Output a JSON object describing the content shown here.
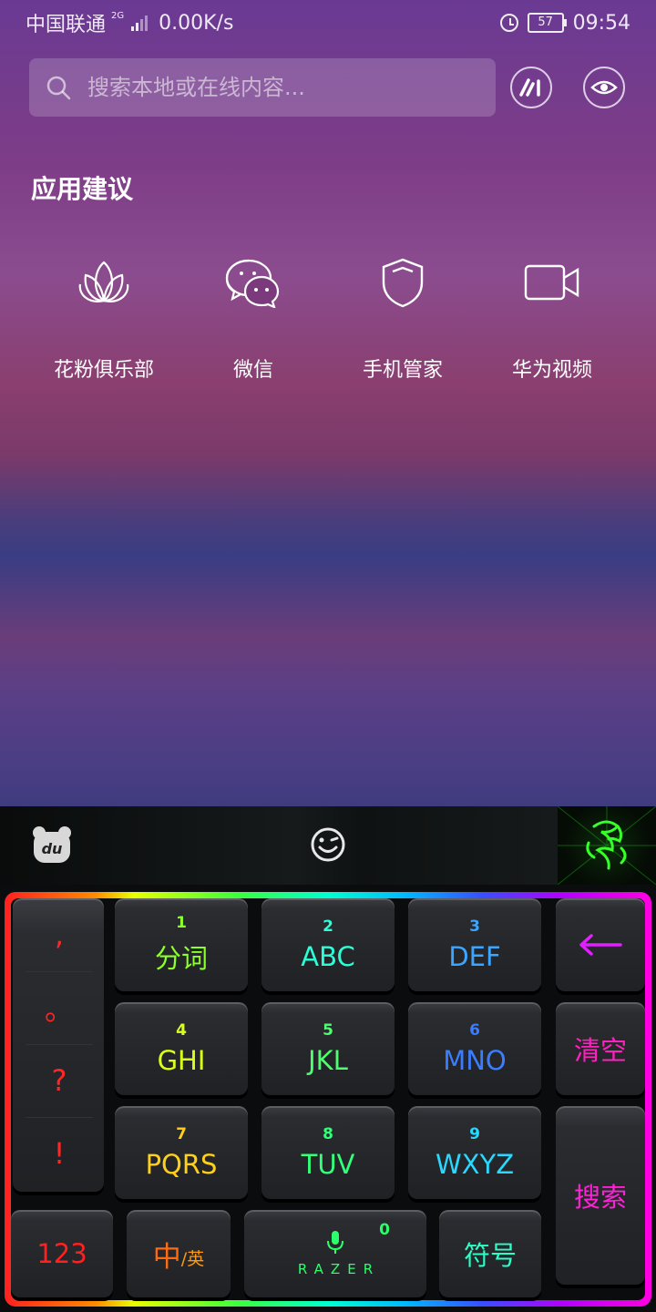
{
  "status_bar": {
    "carrier": "中国联通",
    "network_type": "2G",
    "speed": "0.00K/s",
    "battery": "57",
    "time": "09:54"
  },
  "search": {
    "placeholder": "搜索本地或在线内容..."
  },
  "suggestions": {
    "title": "应用建议",
    "apps": [
      {
        "label": "花粉俱乐部",
        "icon": "lotus-icon"
      },
      {
        "label": "微信",
        "icon": "wechat-icon"
      },
      {
        "label": "手机管家",
        "icon": "shield-icon"
      },
      {
        "label": "华为视频",
        "icon": "video-camera-icon"
      }
    ]
  },
  "keyboard": {
    "punctuation": [
      ",",
      "。",
      "?",
      "!"
    ],
    "keys": [
      {
        "num": "1",
        "label": "分词",
        "color": "#8dff2a"
      },
      {
        "num": "2",
        "label": "ABC",
        "color": "#2bffd8"
      },
      {
        "num": "3",
        "label": "DEF",
        "color": "#3aa6ff"
      },
      {
        "num": "4",
        "label": "GHI",
        "color": "#d9ff1a"
      },
      {
        "num": "5",
        "label": "JKL",
        "color": "#4dff6e"
      },
      {
        "num": "6",
        "label": "MNO",
        "color": "#3a7dff"
      },
      {
        "num": "7",
        "label": "PQRS",
        "color": "#ffcf1a"
      },
      {
        "num": "8",
        "label": "TUV",
        "color": "#32ff7a"
      },
      {
        "num": "9",
        "label": "WXYZ",
        "color": "#29d8ff"
      }
    ],
    "clear_label": "清空",
    "search_label": "搜索",
    "numbers_label": "123",
    "lang_main": "中",
    "lang_sub": "/英",
    "space_num": "0",
    "space_brand": "RAZER",
    "symbols_label": "符号"
  }
}
